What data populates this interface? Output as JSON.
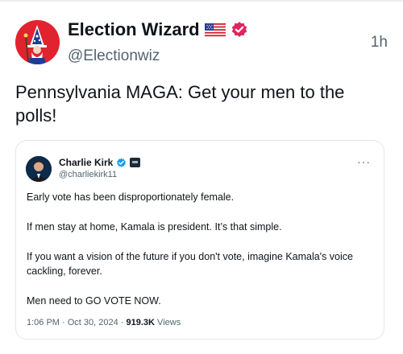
{
  "post": {
    "author_name": "Election Wizard",
    "author_handle": "@Electionwiz",
    "time_ago": "1h",
    "text": "Pennsylvania MAGA: Get your men to the polls!"
  },
  "quoted": {
    "author_name": "Charlie Kirk",
    "author_handle": "@charliekirk11",
    "lines": [
      "Early vote has been disproportionately female.",
      "If men stay at home, Kamala is president. It’s that simple.",
      "If you want a vision of the future if you don't vote, imagine Kamala's voice cackling, forever.",
      "Men need to GO VOTE NOW."
    ],
    "datetime": "1:06 PM · Oct 30, 2024 · ",
    "views_count": "919.3K",
    "views_label": " Views",
    "more_icon": "···"
  },
  "colors": {
    "text": "#0f1419",
    "secondary": "#536471",
    "verified": "#1d9bf0",
    "badge_red": "#e0245e",
    "avatar_bg": "#e0242f"
  },
  "icons": {
    "flag": "us-flag-icon",
    "verified": "verified-badge-icon",
    "affiliation": "affiliation-badge-icon",
    "more": "more-icon"
  }
}
